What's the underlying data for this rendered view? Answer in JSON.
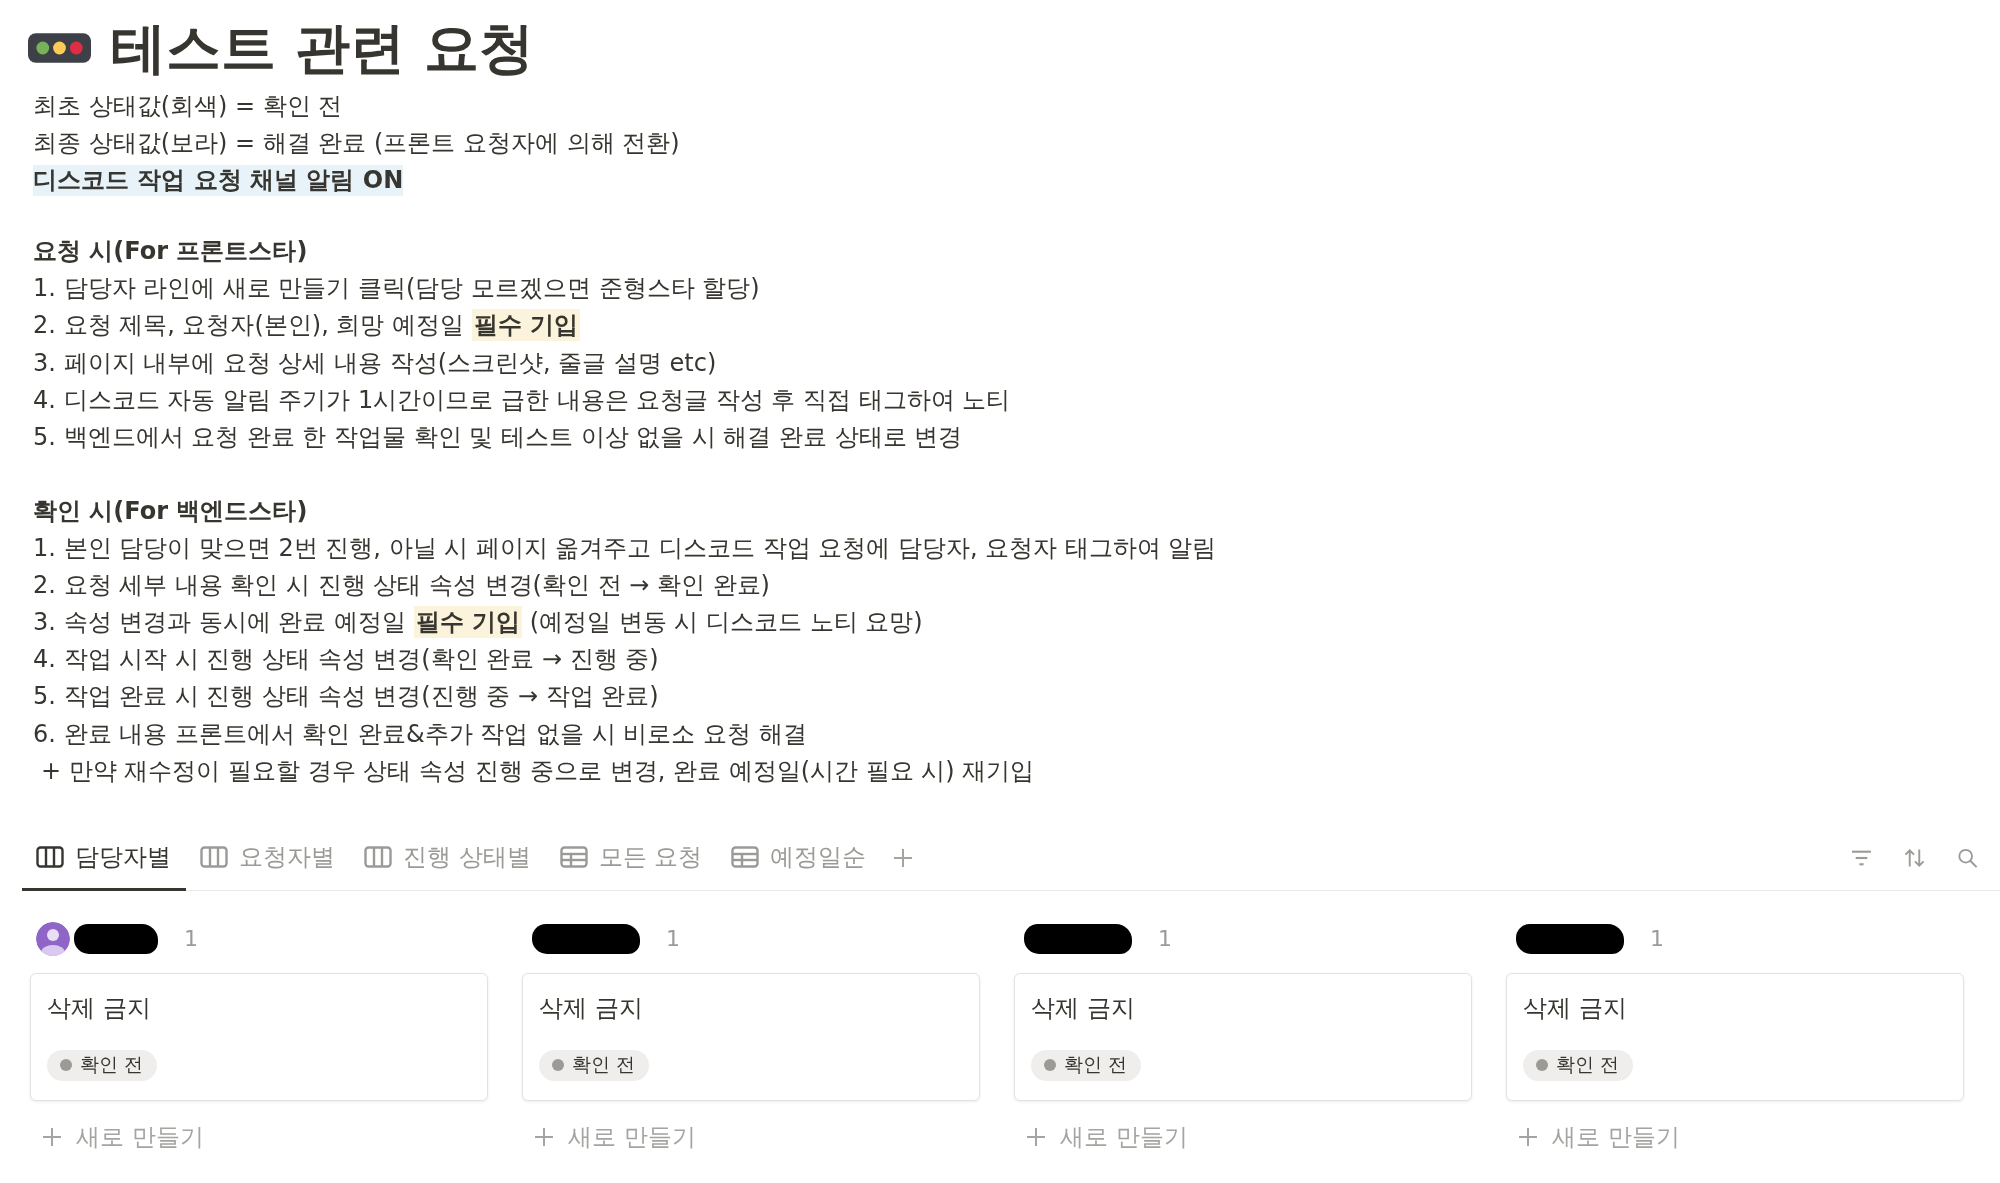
{
  "page": {
    "title": "테스트 관련 요청"
  },
  "intro": [
    {
      "kind": "plain",
      "text": "최초 상태값(회색) = 확인 전"
    },
    {
      "kind": "plain",
      "text": "최종 상태값(보라) = 해결 완료 (프론트 요청자에 의해 전환)"
    },
    {
      "kind": "highlighted",
      "text": "디스코드 작업 요청 채널 알림 ON"
    }
  ],
  "sections": [
    {
      "heading": "요청 시(For 프론트스타)",
      "items": [
        {
          "kind": "step",
          "text": "1. 담당자 라인에 새로 만들기 클릭(담당 모르겠으면 준형스타 할당)"
        },
        {
          "kind": "step",
          "text": "2. 요청 제목, 요청자(본인), 희망 예정일 **필수 기입**"
        },
        {
          "kind": "step",
          "text": "3. 페이지 내부에 요청 상세 내용 작성(스크린샷, 줄글 설명 etc)"
        },
        {
          "kind": "step",
          "text": "4. 디스코드 자동 알림 주기가 1시간이므로 급한 내용은 요청글 작성 후 직접 태그하여 노티"
        },
        {
          "kind": "step",
          "text": "5. 백엔드에서 요청 완료 한 작업물 확인 및 테스트 이상 없을 시 해결 완료 상태로 변경"
        }
      ]
    },
    {
      "heading": "확인 시(For 백엔드스타)",
      "items": [
        {
          "kind": "step",
          "text": "1. 본인 담당이 맞으면 2번 진행, 아닐 시 페이지 옮겨주고 디스코드 작업 요청에 담당자, 요청자 태그하여 알림"
        },
        {
          "kind": "step",
          "text": "2. 요청 세부 내용 확인 시 진행 상태 속성 변경(확인 전 → 확인 완료)"
        },
        {
          "kind": "step",
          "text": "3. 속성 변경과 동시에 완료 예정일 **필수 기입** (예정일 변동 시 디스코드 노티 요망)"
        },
        {
          "kind": "step",
          "text": "4. 작업 시작 시 진행 상태 속성 변경(확인 완료 → 진행 중)"
        },
        {
          "kind": "step",
          "text": "5. 작업 완료 시 진행 상태 속성 변경(진행 중 → 작업 완료)"
        },
        {
          "kind": "step",
          "text": "6. 완료 내용 프론트에서 확인 완료&추가 작업 없을 시 비로소 요청 해결"
        },
        {
          "kind": "note",
          "text": "+ 만약 재수정이 필요할 경우 상태 속성 진행 중으로 변경, 완료 예정일(시간 필요 시) 재기입"
        }
      ]
    }
  ],
  "view_tabs": [
    {
      "label": "담당자별",
      "kind": "board",
      "selected": true
    },
    {
      "label": "요청자별",
      "kind": "board",
      "selected": false
    },
    {
      "label": "진행 상태별",
      "kind": "board",
      "selected": false
    },
    {
      "label": "모든 요청",
      "kind": "table",
      "selected": false
    },
    {
      "label": "예정일순",
      "kind": "table",
      "selected": false
    }
  ],
  "board": {
    "columns": [
      {
        "avatar": true,
        "redacted": true,
        "count": "1",
        "cards": [
          {
            "title": "삭제 금지",
            "status": "확인 전"
          }
        ],
        "new_label": "새로 만들기"
      },
      {
        "avatar": false,
        "redacted": true,
        "count": "1",
        "cards": [
          {
            "title": "삭제 금지",
            "status": "확인 전"
          }
        ],
        "new_label": "새로 만들기"
      },
      {
        "avatar": false,
        "redacted": true,
        "count": "1",
        "cards": [
          {
            "title": "삭제 금지",
            "status": "확인 전"
          }
        ],
        "new_label": "새로 만들기"
      },
      {
        "avatar": false,
        "redacted": true,
        "count": "1",
        "cards": [
          {
            "title": "삭제 금지",
            "status": "확인 전"
          }
        ],
        "new_label": "새로 만들기"
      }
    ]
  }
}
